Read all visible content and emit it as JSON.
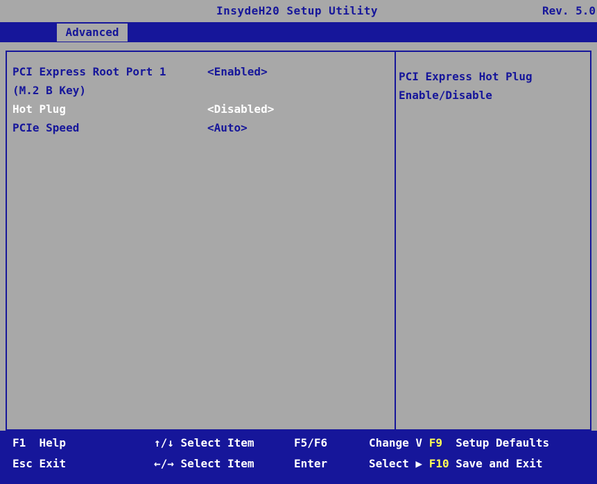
{
  "header": {
    "title": "InsydeH20 Setup Utility",
    "rev": "Rev. 5.0"
  },
  "tabs": [
    {
      "label": "Advanced"
    }
  ],
  "settings": [
    {
      "label_line1": "PCI Express Root Port 1",
      "label_line2": "(M.2 B Key)",
      "value": "<Enabled>"
    },
    {
      "label": "Hot Plug",
      "value": "<Disabled>"
    },
    {
      "label": "PCIe Speed",
      "value": "<Auto>"
    }
  ],
  "help": {
    "line1": "PCI Express Hot Plug",
    "line2": "Enable/Disable"
  },
  "footer": {
    "f1_key": "F1",
    "f1_desc": "Help",
    "esc_key": "Esc",
    "esc_desc": "Exit",
    "updown_key": "↑/↓",
    "updown_desc": "Select Item",
    "leftright_key": "←/→",
    "leftright_desc": "Select Item",
    "f5f6_key": "F5/F6",
    "enter_key": "Enter",
    "change_desc": "Change V",
    "select_desc": "Select ▶",
    "f9_key": "F9",
    "f9_desc": "Setup Defaults",
    "f10_key": "F10",
    "f10_desc": "Save and Exit"
  },
  "colors": {
    "background": "#a8a8a8",
    "accent": "#16169a",
    "highlight": "#ffffff",
    "key": "#ffff55"
  }
}
